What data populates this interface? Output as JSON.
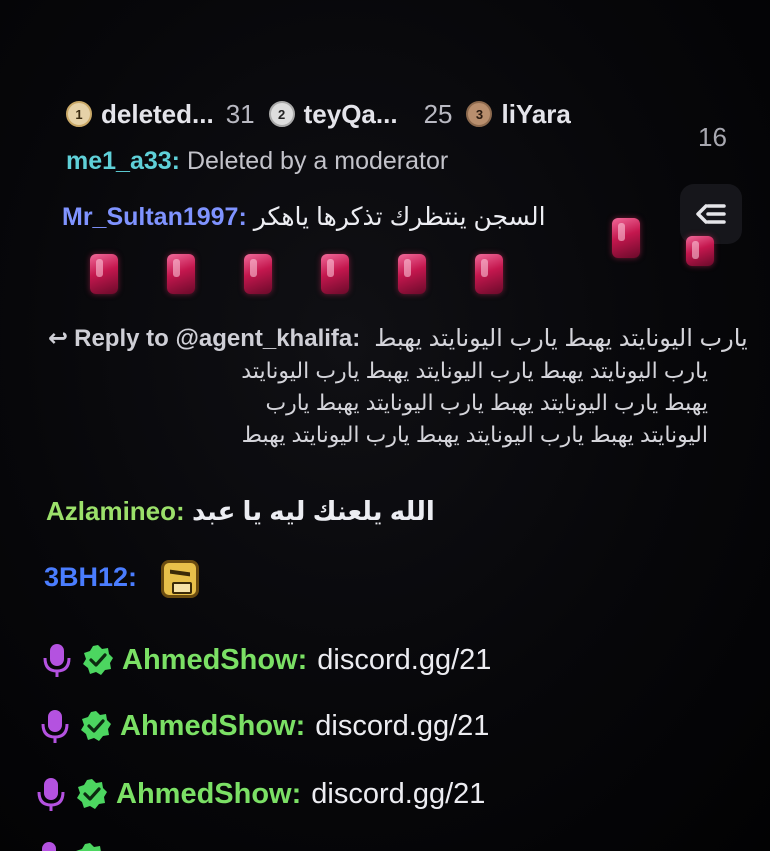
{
  "colors": {
    "deleted_user": "#5fd0d8",
    "mr_sultan": "#7f93ff",
    "azlamineo": "#9be06a",
    "bh12": "#4a7dff",
    "ahmedshow": "#7be065",
    "mic": "#b452e0",
    "verified": "#4cd660"
  },
  "leaderboard": {
    "entries": [
      {
        "rank": "1",
        "name": "deleted...",
        "count": "31",
        "icon": "rank-1-badge-icon"
      },
      {
        "rank": "2",
        "name": "teyQa...",
        "count": "25",
        "icon": "rank-2-badge-icon"
      },
      {
        "rank": "3",
        "name": "liYara",
        "count": "16",
        "icon": "rank-3-badge-icon"
      }
    ]
  },
  "messages": {
    "m1": {
      "user": "me1_a33",
      "colon": ":",
      "text": "Deleted by a moderator"
    },
    "m2": {
      "user": "Mr_Sultan1997",
      "colon": ":",
      "text": "السجن ينتظرك تذكرها ياهكر",
      "emote": "red-gem-emote"
    },
    "m3": {
      "reply_icon": "↩",
      "reply_label": "Reply to @agent_khalifa:",
      "reply_inline": "يارب اليونايتد يهبط يارب اليونايتد يهبط",
      "lines": [
        "يارب اليونايتد يهبط يارب اليونايتد يهبط يارب اليونايتد",
        "يهبط يارب اليونايتد يهبط يارب اليونايتد يهبط يارب",
        "اليونايتد يهبط يارب اليونايتد يهبط يارب اليونايتد يهبط"
      ]
    },
    "m4": {
      "user": "Azlamineo",
      "colon": ":",
      "text": "الله يلعنك ليه يا عبد"
    },
    "m5": {
      "user": "3BH12",
      "colon": ":",
      "emote": "angry-face-emote"
    },
    "ads": [
      {
        "user": "AhmedShow",
        "colon": ":",
        "text": "discord.gg/21"
      },
      {
        "user": "AhmedShow",
        "colon": ":",
        "text": "discord.gg/21"
      },
      {
        "user": "AhmedShow",
        "colon": ":",
        "text": "discord.gg/21"
      }
    ]
  },
  "controls": {
    "collapse_icon": "collapse-chat-icon"
  }
}
